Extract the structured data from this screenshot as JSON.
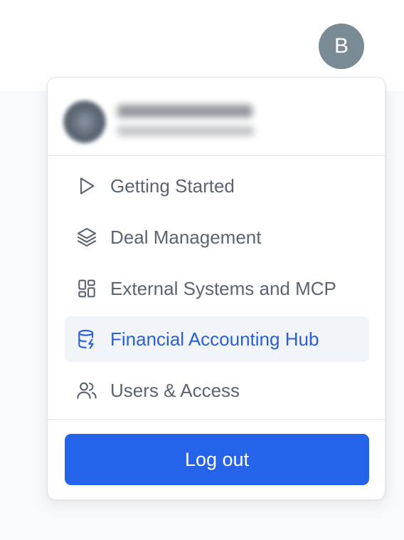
{
  "header": {
    "avatar_initial": "B"
  },
  "menu": {
    "items": [
      {
        "label": "Getting Started",
        "icon": "play-icon",
        "active": false
      },
      {
        "label": "Deal Management",
        "icon": "layers-icon",
        "active": false
      },
      {
        "label": "External Systems and MCP",
        "icon": "grid-icon",
        "active": false
      },
      {
        "label": "Financial Accounting Hub",
        "icon": "database-icon",
        "active": true
      },
      {
        "label": "Users & Access",
        "icon": "users-icon",
        "active": false
      }
    ],
    "logout_label": "Log out"
  },
  "colors": {
    "accent": "#2563e8",
    "active_text": "#2a5fd6",
    "active_bg": "#f1f4f8",
    "text": "#5a6472",
    "avatar_bg": "#7a8b95"
  }
}
